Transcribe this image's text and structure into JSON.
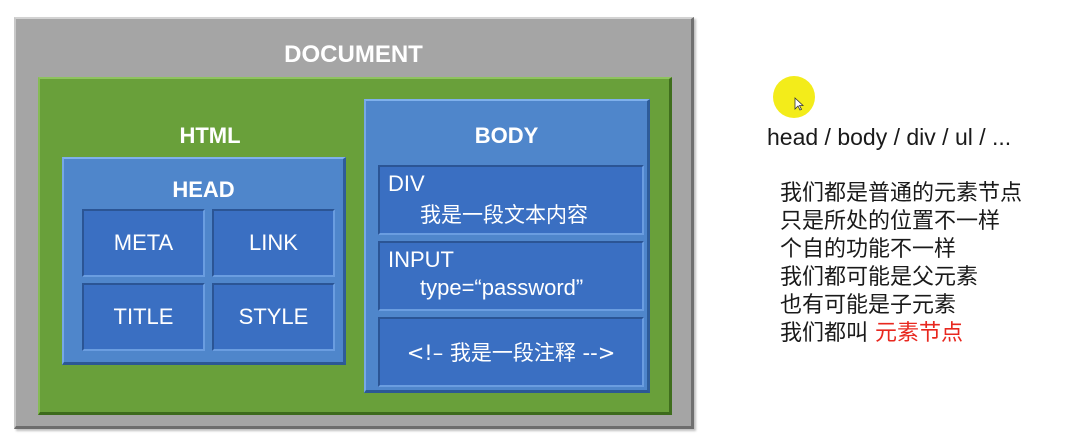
{
  "diagram": {
    "document": {
      "label": "DOCUMENT"
    },
    "html": {
      "label": "HTML"
    },
    "head": {
      "label": "HEAD",
      "children": [
        "META",
        "LINK",
        "TITLE",
        "STYLE"
      ]
    },
    "body": {
      "label": "BODY",
      "div": {
        "line1": "DIV",
        "line2": "我是一段文本内容"
      },
      "input": {
        "line1": "INPUT",
        "line2": "type=“password”"
      },
      "comment": {
        "text": "<!– 我是一段注释 -->"
      }
    }
  },
  "notes": {
    "tags_line": "head / body / div / ul / ...",
    "lines": [
      "我们都是普通的元素节点",
      "只是所处的位置不一样",
      "个自的功能不一样",
      "我们都可能是父元素",
      "也有可能是子元素"
    ],
    "last_prefix": "我们都叫 ",
    "last_highlight": "元素节点"
  },
  "colors": {
    "document": "#a5a5a5",
    "html": "#69a03a",
    "blue": "#4f86cb",
    "cell": "#3a6fc2",
    "highlight_text": "#e8281f",
    "cursor": "#f3ec1a"
  }
}
